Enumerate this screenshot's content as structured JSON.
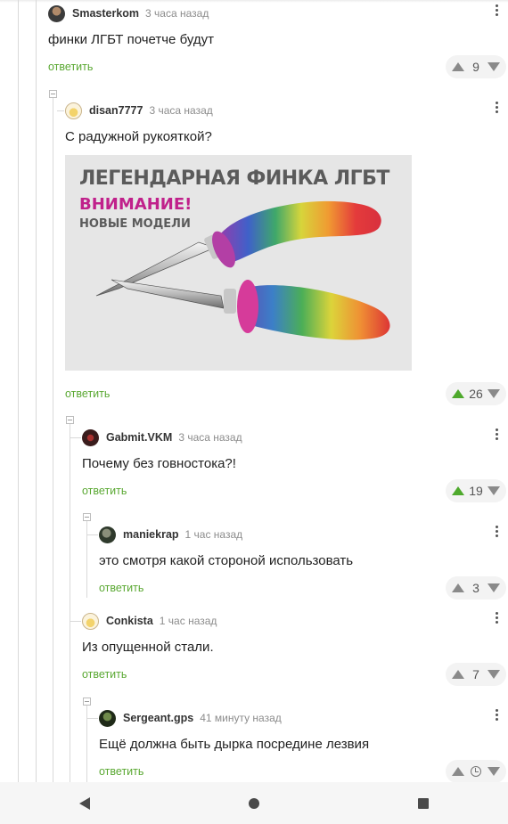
{
  "comments": [
    {
      "author": "Smasterkom",
      "time": "3 часа назад",
      "text": "финки ЛГБТ почетче будут",
      "reply": "ответить",
      "score": "9"
    },
    {
      "author": "disan7777",
      "time": "3 часа назад",
      "text": "С радужной рукояткой?",
      "reply": "ответить",
      "score": "26",
      "image": {
        "line1": "ЛЕГЕНДАРНАЯ ФИНКА ЛГБТ",
        "line2": "ВНИМАНИЕ!",
        "line3": "НОВЫЕ МОДЕЛИ"
      }
    },
    {
      "author": "Gabmit.VKM",
      "time": "3 часа назад",
      "text": "Почему без говностока?!",
      "reply": "ответить",
      "score": "19"
    },
    {
      "author": "maniekrap",
      "time": "1 час назад",
      "text": "это смотря какой стороной использовать",
      "reply": "ответить",
      "score": "3"
    },
    {
      "author": "Conkista",
      "time": "1 час назад",
      "text": "Из опущенной стали.",
      "reply": "ответить",
      "score": "7"
    },
    {
      "author": "Sergeant.gps",
      "time": "41 минуту назад",
      "text": "Ещё должна быть дырка посредине лезвия",
      "reply": "ответить",
      "score": ""
    }
  ],
  "colors": {
    "reply": "#5aa832",
    "upvote_active": "#4ea92c"
  },
  "icons": {
    "menu": "more-vertical-icon",
    "upvote": "arrow-up-icon",
    "downvote": "arrow-down-icon",
    "pending": "clock-icon"
  },
  "navigation": [
    "back-icon",
    "home-icon",
    "recents-icon"
  ]
}
